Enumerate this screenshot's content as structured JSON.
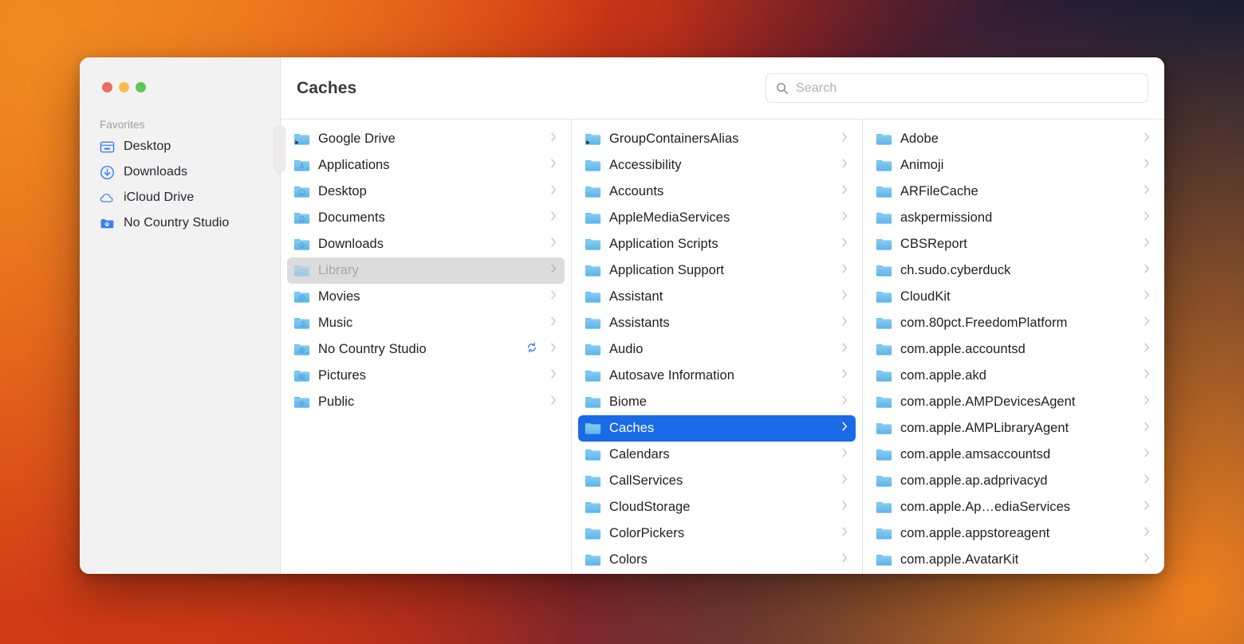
{
  "window": {
    "title": "Caches",
    "traffic_lights": [
      {
        "name": "close-button",
        "color": "#ec6a5f"
      },
      {
        "name": "minimize-button",
        "color": "#f4bd4f"
      },
      {
        "name": "maximize-button",
        "color": "#61c554"
      }
    ]
  },
  "search": {
    "placeholder": "Search",
    "value": "",
    "icon": "search-icon"
  },
  "sidebar": {
    "section_title": "Favorites",
    "items": [
      {
        "label": "Desktop",
        "icon": "desktop-icon"
      },
      {
        "label": "Downloads",
        "icon": "download-circle-icon"
      },
      {
        "label": "iCloud Drive",
        "icon": "cloud-icon"
      },
      {
        "label": "No Country Studio",
        "icon": "folder-home-icon"
      }
    ]
  },
  "columns": [
    {
      "name": "column-home",
      "rows": [
        {
          "label": "Google Drive",
          "icon": "folder-alias-icon",
          "badge": "alias",
          "chevron": true,
          "state": "normal"
        },
        {
          "label": "Applications",
          "icon": "folder-applications-icon",
          "chevron": true,
          "state": "normal"
        },
        {
          "label": "Desktop",
          "icon": "folder-desktop-icon",
          "chevron": true,
          "state": "normal"
        },
        {
          "label": "Documents",
          "icon": "folder-documents-icon",
          "chevron": true,
          "state": "normal"
        },
        {
          "label": "Downloads",
          "icon": "folder-downloads-icon",
          "chevron": true,
          "state": "normal"
        },
        {
          "label": "Library",
          "icon": "folder-library-icon",
          "chevron": true,
          "state": "inactive-selected"
        },
        {
          "label": "Movies",
          "icon": "folder-movies-icon",
          "chevron": true,
          "state": "normal"
        },
        {
          "label": "Music",
          "icon": "folder-music-icon",
          "chevron": true,
          "state": "normal"
        },
        {
          "label": "No Country Studio",
          "icon": "folder-cloud-icon",
          "chevron": true,
          "state": "normal",
          "sync": true
        },
        {
          "label": "Pictures",
          "icon": "folder-pictures-icon",
          "chevron": true,
          "state": "normal"
        },
        {
          "label": "Public",
          "icon": "folder-public-icon",
          "chevron": true,
          "state": "normal"
        }
      ]
    },
    {
      "name": "column-library",
      "rows": [
        {
          "label": "GroupContainersAlias",
          "icon": "folder-alias-icon",
          "badge": "alias",
          "chevron": true,
          "state": "normal"
        },
        {
          "label": "Accessibility",
          "icon": "folder-icon",
          "chevron": true,
          "state": "normal"
        },
        {
          "label": "Accounts",
          "icon": "folder-icon",
          "chevron": true,
          "state": "normal"
        },
        {
          "label": "AppleMediaServices",
          "icon": "folder-icon",
          "chevron": true,
          "state": "normal"
        },
        {
          "label": "Application Scripts",
          "icon": "folder-icon",
          "chevron": true,
          "state": "normal"
        },
        {
          "label": "Application Support",
          "icon": "folder-icon",
          "chevron": true,
          "state": "normal"
        },
        {
          "label": "Assistant",
          "icon": "folder-icon",
          "chevron": true,
          "state": "normal"
        },
        {
          "label": "Assistants",
          "icon": "folder-icon",
          "chevron": true,
          "state": "normal"
        },
        {
          "label": "Audio",
          "icon": "folder-icon",
          "chevron": true,
          "state": "normal"
        },
        {
          "label": "Autosave Information",
          "icon": "folder-icon",
          "chevron": true,
          "state": "normal"
        },
        {
          "label": "Biome",
          "icon": "folder-icon",
          "chevron": true,
          "state": "normal"
        },
        {
          "label": "Caches",
          "icon": "folder-icon",
          "chevron": true,
          "state": "selected"
        },
        {
          "label": "Calendars",
          "icon": "folder-icon",
          "chevron": true,
          "state": "normal"
        },
        {
          "label": "CallServices",
          "icon": "folder-icon",
          "chevron": true,
          "state": "normal"
        },
        {
          "label": "CloudStorage",
          "icon": "folder-icon",
          "chevron": true,
          "state": "normal"
        },
        {
          "label": "ColorPickers",
          "icon": "folder-icon",
          "chevron": true,
          "state": "normal"
        },
        {
          "label": "Colors",
          "icon": "folder-icon",
          "chevron": true,
          "state": "normal"
        }
      ]
    },
    {
      "name": "column-caches",
      "rows": [
        {
          "label": "Adobe",
          "icon": "folder-icon",
          "chevron": true,
          "state": "normal"
        },
        {
          "label": "Animoji",
          "icon": "folder-icon",
          "chevron": true,
          "state": "normal"
        },
        {
          "label": "ARFileCache",
          "icon": "folder-icon",
          "chevron": true,
          "state": "normal"
        },
        {
          "label": "askpermissiond",
          "icon": "folder-icon",
          "chevron": true,
          "state": "normal"
        },
        {
          "label": "CBSReport",
          "icon": "folder-icon",
          "chevron": true,
          "state": "normal"
        },
        {
          "label": "ch.sudo.cyberduck",
          "icon": "folder-icon",
          "chevron": true,
          "state": "normal"
        },
        {
          "label": "CloudKit",
          "icon": "folder-icon",
          "chevron": true,
          "state": "normal"
        },
        {
          "label": "com.80pct.FreedomPlatform",
          "icon": "folder-icon",
          "chevron": true,
          "state": "normal"
        },
        {
          "label": "com.apple.accountsd",
          "icon": "folder-icon",
          "chevron": true,
          "state": "normal"
        },
        {
          "label": "com.apple.akd",
          "icon": "folder-icon",
          "chevron": true,
          "state": "normal"
        },
        {
          "label": "com.apple.AMPDevicesAgent",
          "icon": "folder-icon",
          "chevron": true,
          "state": "normal"
        },
        {
          "label": "com.apple.AMPLibraryAgent",
          "icon": "folder-icon",
          "chevron": true,
          "state": "normal"
        },
        {
          "label": "com.apple.amsaccountsd",
          "icon": "folder-icon",
          "chevron": true,
          "state": "normal"
        },
        {
          "label": "com.apple.ap.adprivacyd",
          "icon": "folder-icon",
          "chevron": true,
          "state": "normal"
        },
        {
          "label": "com.apple.Ap…ediaServices",
          "icon": "folder-icon",
          "chevron": true,
          "state": "normal"
        },
        {
          "label": "com.apple.appstoreagent",
          "icon": "folder-icon",
          "chevron": true,
          "state": "normal"
        },
        {
          "label": "com.apple.AvatarKit",
          "icon": "folder-icon",
          "chevron": true,
          "state": "normal"
        }
      ]
    }
  ],
  "colors": {
    "selection_blue": "#1a6ae8",
    "inactive_selection": "#dcdcdc",
    "sidebar_bg": "#f3f2f3",
    "accent_icon_blue": "#3b7ff5",
    "folder_blue": "#6ec2f0"
  }
}
